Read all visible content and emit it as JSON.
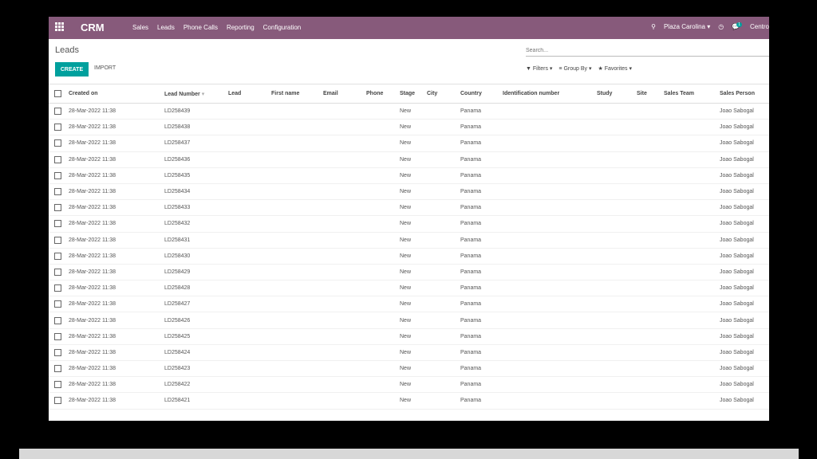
{
  "nav": {
    "brand": "CRM",
    "menu": [
      "Sales",
      "Leads",
      "Phone Calls",
      "Reporting",
      "Configuration"
    ],
    "company": "Plaza Carolina",
    "message_count": "1",
    "user": "Centro"
  },
  "control": {
    "title": "Leads",
    "create_label": "CREATE",
    "import_label": "IMPORT",
    "search_placeholder": "Search...",
    "filters_label": "Filters",
    "groupby_label": "Group By",
    "favorites_label": "Favorites"
  },
  "table": {
    "columns": [
      "Created on",
      "Lead Number",
      "Lead",
      "First name",
      "Email",
      "Phone",
      "Stage",
      "City",
      "Country",
      "Identification number",
      "Study",
      "Site",
      "Sales Team",
      "Sales Person"
    ],
    "rows": [
      {
        "created": "28-Mar-2022 11:38",
        "number": "LD258439",
        "stage": "New",
        "country": "Panama",
        "person": "Joao Sabogal"
      },
      {
        "created": "28-Mar-2022 11:38",
        "number": "LD258438",
        "stage": "New",
        "country": "Panama",
        "person": "Joao Sabogal"
      },
      {
        "created": "28-Mar-2022 11:38",
        "number": "LD258437",
        "stage": "New",
        "country": "Panama",
        "person": "Joao Sabogal"
      },
      {
        "created": "28-Mar-2022 11:38",
        "number": "LD258436",
        "stage": "New",
        "country": "Panama",
        "person": "Joao Sabogal"
      },
      {
        "created": "28-Mar-2022 11:38",
        "number": "LD258435",
        "stage": "New",
        "country": "Panama",
        "person": "Joao Sabogal"
      },
      {
        "created": "28-Mar-2022 11:38",
        "number": "LD258434",
        "stage": "New",
        "country": "Panama",
        "person": "Joao Sabogal"
      },
      {
        "created": "28-Mar-2022 11:38",
        "number": "LD258433",
        "stage": "New",
        "country": "Panama",
        "person": "Joao Sabogal"
      },
      {
        "created": "28-Mar-2022 11:38",
        "number": "LD258432",
        "stage": "New",
        "country": "Panama",
        "person": "Joao Sabogal"
      },
      {
        "created": "28-Mar-2022 11:38",
        "number": "LD258431",
        "stage": "New",
        "country": "Panama",
        "person": "Joao Sabogal"
      },
      {
        "created": "28-Mar-2022 11:38",
        "number": "LD258430",
        "stage": "New",
        "country": "Panama",
        "person": "Joao Sabogal"
      },
      {
        "created": "28-Mar-2022 11:38",
        "number": "LD258429",
        "stage": "New",
        "country": "Panama",
        "person": "Joao Sabogal"
      },
      {
        "created": "28-Mar-2022 11:38",
        "number": "LD258428",
        "stage": "New",
        "country": "Panama",
        "person": "Joao Sabogal"
      },
      {
        "created": "28-Mar-2022 11:38",
        "number": "LD258427",
        "stage": "New",
        "country": "Panama",
        "person": "Joao Sabogal"
      },
      {
        "created": "28-Mar-2022 11:38",
        "number": "LD258426",
        "stage": "New",
        "country": "Panama",
        "person": "Joao Sabogal"
      },
      {
        "created": "28-Mar-2022 11:38",
        "number": "LD258425",
        "stage": "New",
        "country": "Panama",
        "person": "Joao Sabogal"
      },
      {
        "created": "28-Mar-2022 11:38",
        "number": "LD258424",
        "stage": "New",
        "country": "Panama",
        "person": "Joao Sabogal"
      },
      {
        "created": "28-Mar-2022 11:38",
        "number": "LD258423",
        "stage": "New",
        "country": "Panama",
        "person": "Joao Sabogal"
      },
      {
        "created": "28-Mar-2022 11:38",
        "number": "LD258422",
        "stage": "New",
        "country": "Panama",
        "person": "Joao Sabogal"
      },
      {
        "created": "28-Mar-2022 11:38",
        "number": "LD258421",
        "stage": "New",
        "country": "Panama",
        "person": "Joao Sabogal"
      }
    ]
  },
  "colors": {
    "topbar": "#875a7b",
    "primary": "#00a09d"
  }
}
